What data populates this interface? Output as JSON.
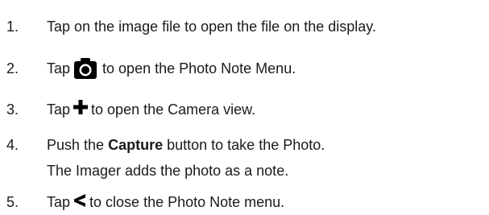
{
  "steps": [
    {
      "number": "1.",
      "text": "Tap on the image file to open the file on the display."
    },
    {
      "number": "2.",
      "before": "Tap",
      "icon": "camera-icon",
      "after": "to open the Photo Note Menu."
    },
    {
      "number": "3.",
      "before": "Tap",
      "icon": "plus-icon",
      "after": "to open the Camera view."
    },
    {
      "number": "4.",
      "before": "Push the",
      "bold": "Capture",
      "after": "button to take the Photo.",
      "continuation": "The Imager adds the photo as a note."
    },
    {
      "number": "5.",
      "before": "Tap",
      "icon": "less-than-icon",
      "after": "to close the Photo Note menu."
    }
  ],
  "colors": {
    "text": "#1a1a1a",
    "icon": "#000000"
  }
}
